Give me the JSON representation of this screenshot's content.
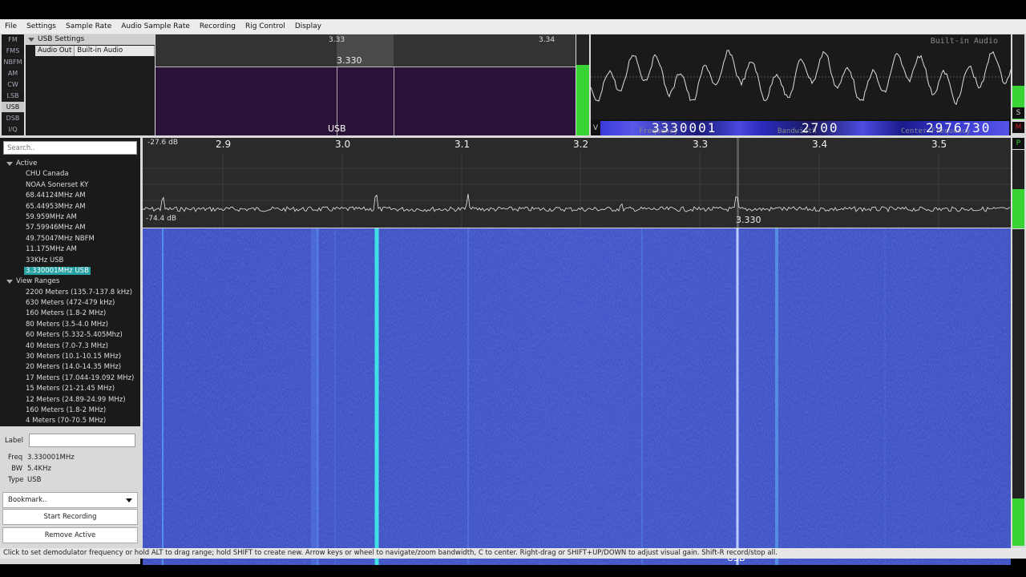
{
  "menu": [
    "File",
    "Settings",
    "Sample Rate",
    "Audio Sample Rate",
    "Recording",
    "Rig Control",
    "Display"
  ],
  "modes": [
    {
      "label": "FM",
      "active": false
    },
    {
      "label": "FMS",
      "active": false
    },
    {
      "label": "NBFM",
      "active": false
    },
    {
      "label": "AM",
      "active": false
    },
    {
      "label": "CW",
      "active": false
    },
    {
      "label": "LSB",
      "active": false
    },
    {
      "label": "USB",
      "active": true
    },
    {
      "label": "DSB",
      "active": false
    },
    {
      "label": "I/Q",
      "active": false
    }
  ],
  "settings": {
    "title": "USB Settings",
    "audio_out_label": "Audio Out",
    "audio_out_value": "Built-in Audio"
  },
  "demod_view": {
    "tick_left": "3.33",
    "tick_right": "3.34",
    "center_freq": "3.330",
    "mode_label": "USB"
  },
  "scope": {
    "device_label": "Built-in Audio"
  },
  "readouts": {
    "frequency_label": "Frequency",
    "frequency_value": "3330001",
    "bandwidth_label": "Bandwidth",
    "bandwidth_value": "2700",
    "center_label": "Center Frequency",
    "center_value": "2976730"
  },
  "side_letters": {
    "v": "V",
    "s": "S",
    "m": "M",
    "p": "P"
  },
  "search": {
    "placeholder": "Search.."
  },
  "bookmarks": {
    "active_label": "Active",
    "active": [
      "CHU Canada",
      "NOAA Sonerset KY",
      "68.44124MHz AM",
      "65.44953MHz AM",
      "59.959MHz AM",
      "57.59946MHz AM",
      "49.75047MHz NBFM",
      "11.175MHz AM",
      "33KHz USB"
    ],
    "active_selected": "3.330001MHz USB",
    "ranges_label": "View Ranges",
    "ranges": [
      "2200 Meters (135.7-137.8 kHz)",
      "630 Meters (472-479 kHz)",
      "160 Meters (1.8-2 MHz)",
      "80 Meters (3.5-4.0 MHz)",
      "60 Meters (5.332-5.405Mhz)",
      "40 Meters (7.0-7.3 MHz)",
      "30 Meters (10.1-10.15 MHz)",
      "20 Meters (14.0-14.35 MHz)",
      "17 Meters (17.044-19.092 MHz)",
      "15 Meters (21-21.45 MHz)",
      "12 Meters (24.89-24.99 MHz)",
      "160 Meters (1.8-2 MHz)",
      "4 Meters (70-70.5 MHz)"
    ]
  },
  "details": {
    "label_label": "Label",
    "freq_key": "Freq",
    "freq_value": "3.330001MHz",
    "bw_key": "BW",
    "bw_value": "5.4KHz",
    "type_key": "Type",
    "type_value": "USB",
    "bookmark_button": "Bookmark..",
    "start_recording": "Start Recording",
    "remove_active": "Remove Active"
  },
  "spectrum": {
    "top_db": "-27.6 dB",
    "bottom_db": "-74.4 dB",
    "ticks": [
      "2.9",
      "3.0",
      "3.1",
      "3.2",
      "3.3",
      "3.4",
      "3.5"
    ],
    "marker_freq": "3.330"
  },
  "waterfall": {
    "mode_label": "USB"
  },
  "status": "Click to set demodulator frequency or hold ALT to drag range; hold SHIFT to create new. Arrow keys or wheel to navigate/zoom bandwidth, C to center. Right-drag or SHIFT+UP/DOWN to adjust visual gain. Shift-R record/stop all.",
  "colors": {
    "meter": "#39d336",
    "waterfall_bg": "#3a4fc4",
    "signal": "#3fe0e6",
    "selection": "#26a0a0",
    "demod_bg": "#2b1238"
  }
}
